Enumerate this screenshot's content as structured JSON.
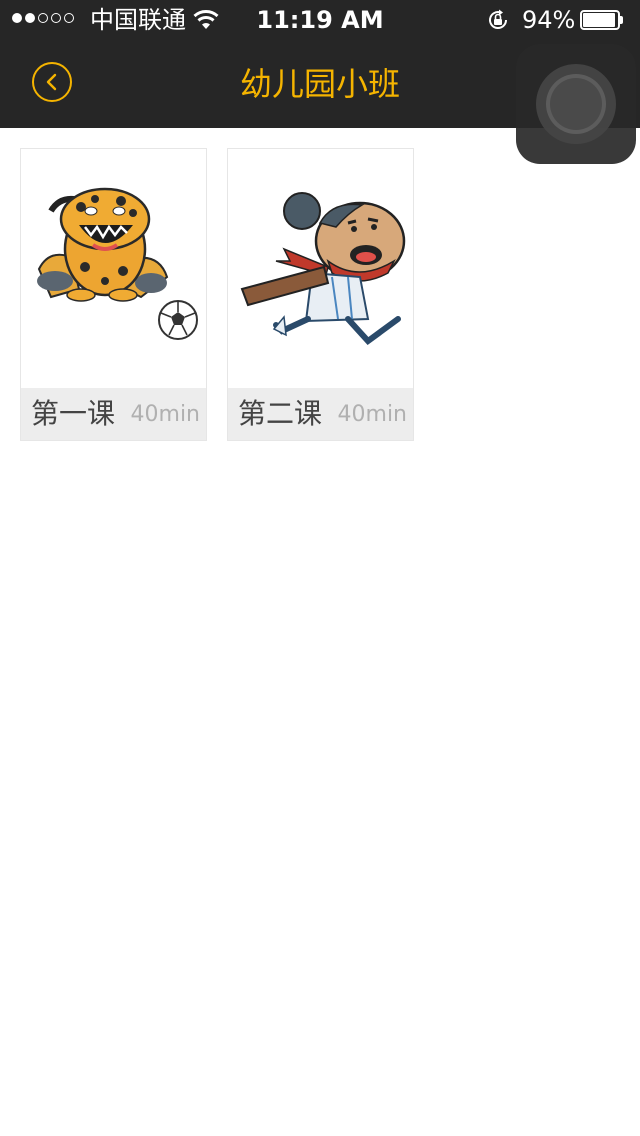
{
  "status_bar": {
    "carrier": "中国联通",
    "time": "11:19 AM",
    "battery_percent": "94%",
    "battery_level": 0.94,
    "signal_bars_filled": 2,
    "signal_bars_total": 5
  },
  "nav": {
    "title": "幼儿园小班",
    "accent_color": "#f5b400"
  },
  "lessons": [
    {
      "name": "第一课",
      "duration": "40min",
      "icon": "leopard-soccer-mascot"
    },
    {
      "name": "第二课",
      "duration": "40min",
      "icon": "running-boy-cartoon"
    }
  ]
}
